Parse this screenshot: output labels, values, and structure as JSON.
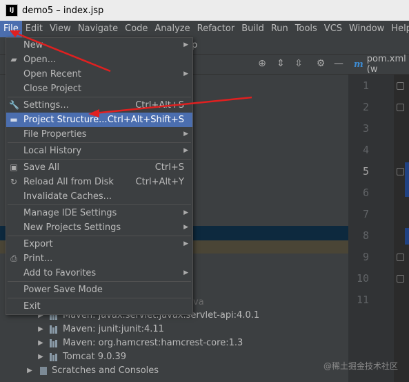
{
  "window": {
    "title": "demo5 – index.jsp",
    "icon_text": "IJ"
  },
  "menubar": [
    "File",
    "Edit",
    "View",
    "Navigate",
    "Code",
    "Analyze",
    "Refactor",
    "Build",
    "Run",
    "Tools",
    "VCS",
    "Window",
    "Help"
  ],
  "breadcrumb_fragment": "p",
  "file_menu": {
    "items": [
      {
        "label": "New",
        "shortcut": "",
        "submenu": true
      },
      {
        "label": "Open...",
        "shortcut": "",
        "submenu": false
      },
      {
        "label": "Open Recent",
        "shortcut": "",
        "submenu": true
      },
      {
        "label": "Close Project",
        "shortcut": "",
        "submenu": false
      },
      {
        "label": "Settings...",
        "shortcut": "Ctrl+Alt+S",
        "submenu": false
      },
      {
        "label": "Project Structure...",
        "shortcut": "Ctrl+Alt+Shift+S",
        "submenu": false,
        "highlighted": true
      },
      {
        "label": "File Properties",
        "shortcut": "",
        "submenu": true
      },
      {
        "label": "Local History",
        "shortcut": "",
        "submenu": true
      },
      {
        "label": "Save All",
        "shortcut": "Ctrl+S",
        "submenu": false
      },
      {
        "label": "Reload All from Disk",
        "shortcut": "Ctrl+Alt+Y",
        "submenu": false
      },
      {
        "label": "Invalidate Caches...",
        "shortcut": "",
        "submenu": false
      },
      {
        "label": "Manage IDE Settings",
        "shortcut": "",
        "submenu": true
      },
      {
        "label": "New Projects Settings",
        "shortcut": "",
        "submenu": true
      },
      {
        "label": "Export",
        "shortcut": "",
        "submenu": true
      },
      {
        "label": "Print...",
        "shortcut": "",
        "submenu": false
      },
      {
        "label": "Add to Favorites",
        "shortcut": "",
        "submenu": true
      },
      {
        "label": "Power Save Mode",
        "shortcut": "",
        "submenu": false
      },
      {
        "label": "Exit",
        "shortcut": "",
        "submenu": false
      }
    ]
  },
  "project_tree": {
    "ghost_text": "va",
    "rows": [
      "Maven: javax.servlet:javax.servlet-api:4.0.1",
      "Maven: junit:junit:4.11",
      "Maven: org.hamcrest:hamcrest-core:1.3",
      "Tomcat 9.0.39",
      "Scratches and Consoles"
    ]
  },
  "editor": {
    "tab_icon": "m",
    "tab_label": "pom.xml (w",
    "line_numbers": [
      "1",
      "2",
      "3",
      "4",
      "5",
      "6",
      "7",
      "8",
      "9",
      "10",
      "11"
    ],
    "current_line": "5"
  },
  "watermark": "@稀土掘金技术社区",
  "colors": {
    "menu_highlight": "#4b6eaf",
    "annotation_arrow": "#e02020"
  }
}
